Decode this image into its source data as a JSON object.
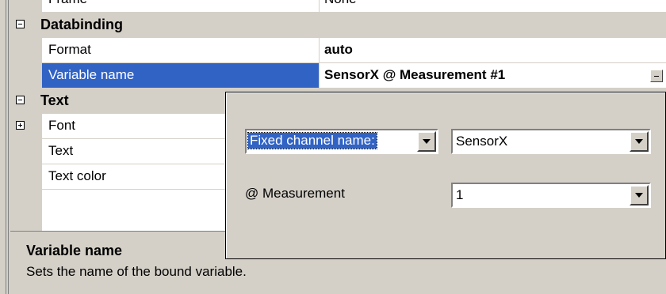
{
  "properties": {
    "partial_row": {
      "name": "Frame",
      "value": "None"
    },
    "categories": [
      {
        "title": "Databinding",
        "rows": [
          {
            "name": "Format",
            "value": "auto"
          },
          {
            "name": "Variable name",
            "value": "SensorX @ Measurement #1"
          }
        ]
      },
      {
        "title": "Text",
        "rows": [
          {
            "name": "Font",
            "value": ""
          },
          {
            "name": "Text",
            "value": ""
          },
          {
            "name": "Text color",
            "value": ""
          }
        ]
      }
    ],
    "selected_row": "Variable name"
  },
  "help": {
    "title": "Variable name",
    "description": "Sets the name of the bound variable."
  },
  "popup": {
    "mode_select": "Fixed channel name:",
    "channel_select": "SensorX",
    "measurement_label": "@ Measurement",
    "measurement_select": "1"
  },
  "colors": {
    "selection": "#3163c5",
    "face": "#d4d0c8"
  }
}
